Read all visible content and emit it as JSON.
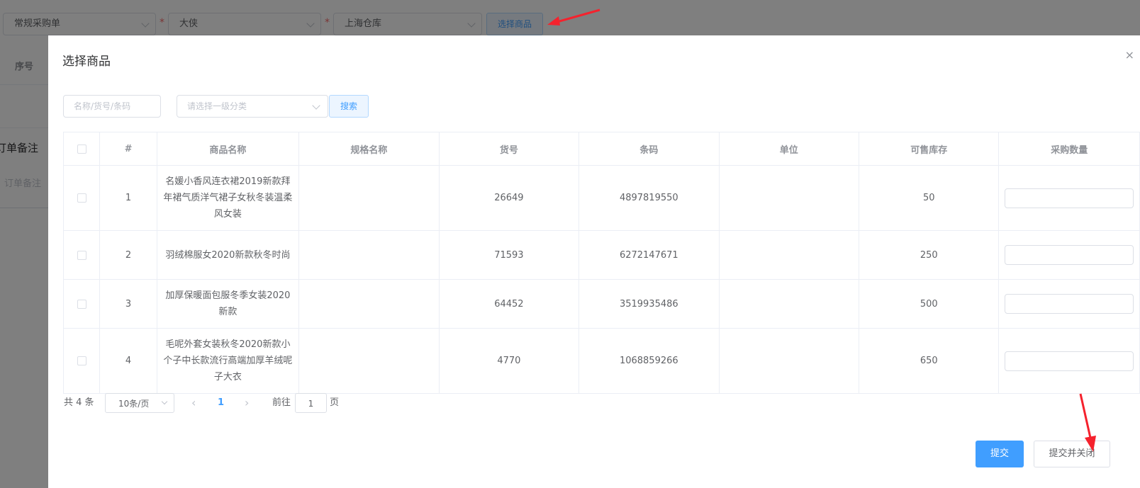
{
  "background": {
    "order_type": "常规采购单",
    "supplier": "大侠",
    "warehouse": "上海仓库",
    "choose_goods_label": "选择商品",
    "seq_header": "序号",
    "order_note_title": "订单备注",
    "order_note_placeholder": "订单备注"
  },
  "dialog": {
    "title": "选择商品",
    "close_glyph": "×",
    "filter": {
      "keyword_placeholder": "名称/货号/条码",
      "category_placeholder": "请选择一级分类",
      "search_label": "搜索"
    },
    "table": {
      "columns": [
        "#",
        "商品名称",
        "规格名称",
        "货号",
        "条码",
        "单位",
        "可售库存",
        "采购数量"
      ],
      "rows": [
        {
          "index": "1",
          "name": "名媛小香风连衣裙2019新款拜年裙气质洋气裙子女秋冬装温柔风女装",
          "spec": "",
          "sku": "26649",
          "barcode": "4897819550",
          "unit": "",
          "stock": "50",
          "qty": ""
        },
        {
          "index": "2",
          "name": "羽绒棉服女2020新款秋冬时尚",
          "spec": "",
          "sku": "71593",
          "barcode": "6272147671",
          "unit": "",
          "stock": "250",
          "qty": ""
        },
        {
          "index": "3",
          "name": "加厚保暖面包服冬季女装2020新款",
          "spec": "",
          "sku": "64452",
          "barcode": "3519935486",
          "unit": "",
          "stock": "500",
          "qty": ""
        },
        {
          "index": "4",
          "name": "毛呢外套女装秋冬2020新款小个子中长款流行高端加厚羊绒呢子大衣",
          "spec": "",
          "sku": "4770",
          "barcode": "1068859266",
          "unit": "",
          "stock": "650",
          "qty": ""
        }
      ]
    },
    "pagination": {
      "total_text": "共 4 条",
      "page_size": "10条/页",
      "prev_glyph": "‹",
      "current_page": "1",
      "next_glyph": "›",
      "goto_prefix": "前往",
      "goto_value": "1",
      "goto_suffix": "页"
    },
    "footer": {
      "submit_label": "提交",
      "submit_close_label": "提交并关闭"
    }
  },
  "colors": {
    "primary": "#409eff",
    "annotation_arrow": "#f5222d"
  }
}
